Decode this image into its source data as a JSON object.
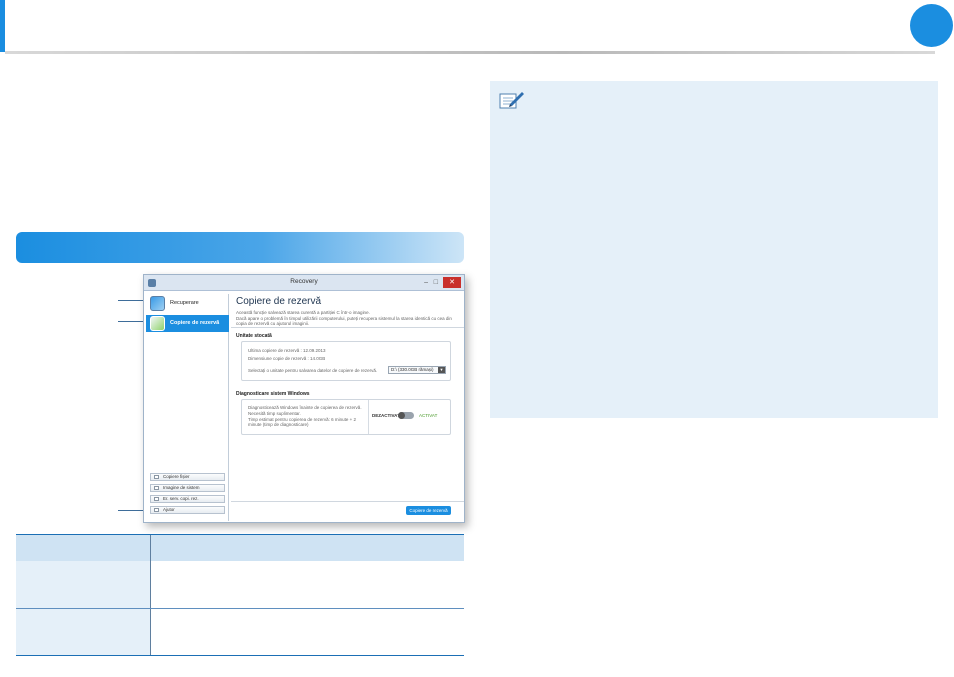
{
  "app": {
    "title": "Recovery",
    "window_min": "–",
    "window_max": "□",
    "window_close": "✕",
    "sidebar": {
      "items": [
        {
          "label": "Recuperare",
          "active": false
        },
        {
          "label": "Copiere de rezervă",
          "active": true
        }
      ],
      "buttons": [
        {
          "label": "Copiere fișier"
        },
        {
          "label": "Imagine de sistem"
        },
        {
          "label": "Er. serv. copi. rez."
        },
        {
          "label": "Ajutor"
        }
      ]
    },
    "content": {
      "title": "Copiere de rezervă",
      "desc1": "Această funcție salvează starea curentă a partiției C într-o imagine.",
      "desc2": "Dacă apare o problemă în timpul utilizării computerului, puteți recupera sistemul la starea identică cu cea din copia de rezervă cu ajutorul imaginii.",
      "section1": {
        "heading": "Unitate stocată",
        "last_backup": "Ultima copiere de rezervă : 12.09.2013",
        "backup_size": "Dimensiune copie de rezervă : 14.0GB",
        "select_label": "Selectați o unitate pentru salvarea datelor de copiere de rezervă.",
        "select_value": "D:\\ (330.0GB rămași)",
        "select_arrow": "▼"
      },
      "section2": {
        "heading": "Diagnosticare sistem Windows",
        "text1": "Diagnosticează Windows înainte de copierea de rezervă.",
        "text2": "Necesită timp suplimentar.",
        "text3": "Timp estimat pentru copierea de rezervă: 6 minute + 2 minute (timp de diagnosticare)",
        "off_label": "DEZACTIVAT",
        "on_label": "ACTIVAT"
      },
      "primary_button": "Copiere de rezervă"
    }
  },
  "colors": {
    "accent": "#1b8ee0",
    "note_bg": "#e5f0f9",
    "table_header": "#cfe3f3"
  },
  "icons": [
    "note-pen-icon",
    "recovery-icon",
    "backup-icon",
    "close-icon"
  ]
}
